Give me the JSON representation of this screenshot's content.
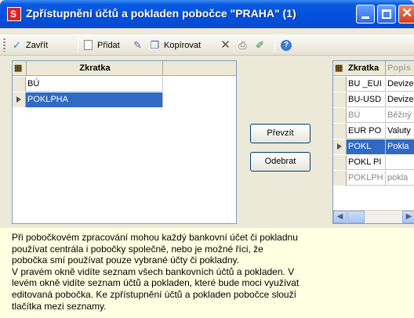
{
  "window": {
    "title": "Zpřístupnění účtů a pokladen pobočce \"PRAHA\" (1)",
    "icon": "S"
  },
  "toolbar": {
    "close_label": "Zavřít",
    "add_label": "Přidat",
    "copy_label": "Kopírovat"
  },
  "left_grid": {
    "header": "Zkratka",
    "rows": [
      {
        "zkratka": "BÚ"
      },
      {
        "zkratka": "POKLPHA"
      }
    ]
  },
  "buttons": {
    "take": "Převzít",
    "remove": "Odebrat"
  },
  "right_grid": {
    "headers": [
      "Zkratka",
      "Popis"
    ],
    "rows": [
      {
        "zkratka": "BU _EUI",
        "popis": "Devize"
      },
      {
        "zkratka": "BU-USD",
        "popis": "Devize"
      },
      {
        "zkratka": "BÚ",
        "popis": "Běžný"
      },
      {
        "zkratka": "EUR PO",
        "popis": "Valuty"
      },
      {
        "zkratka": "POKL",
        "popis": "Pokla"
      },
      {
        "zkratka": "POKL PI",
        "popis": ""
      },
      {
        "zkratka": "POKLPH",
        "popis": "pokla"
      }
    ]
  },
  "info_lines": [
    "Při pobočkovém zpracování mohou každý bankovní účet či pokladnu",
    "používat centrála i pobočky společně, nebo je možné říci, že",
    "pobočka smí používat pouze vybrané účty či pokladny.",
    "V pravém okně vidíte seznam všech bankovních účtů a pokladen. V",
    "levém okně vidíte seznam účtů a pokladen, které bude moci využívat",
    "editovaná pobočka. Ke zpřístupnění účtů a pokladen pobočce slouží",
    "tlačítka mezi seznamy."
  ],
  "colors": {
    "titlebar": "#0050dc",
    "selection": "#316ac5",
    "info_bg": "#ffffe1"
  }
}
